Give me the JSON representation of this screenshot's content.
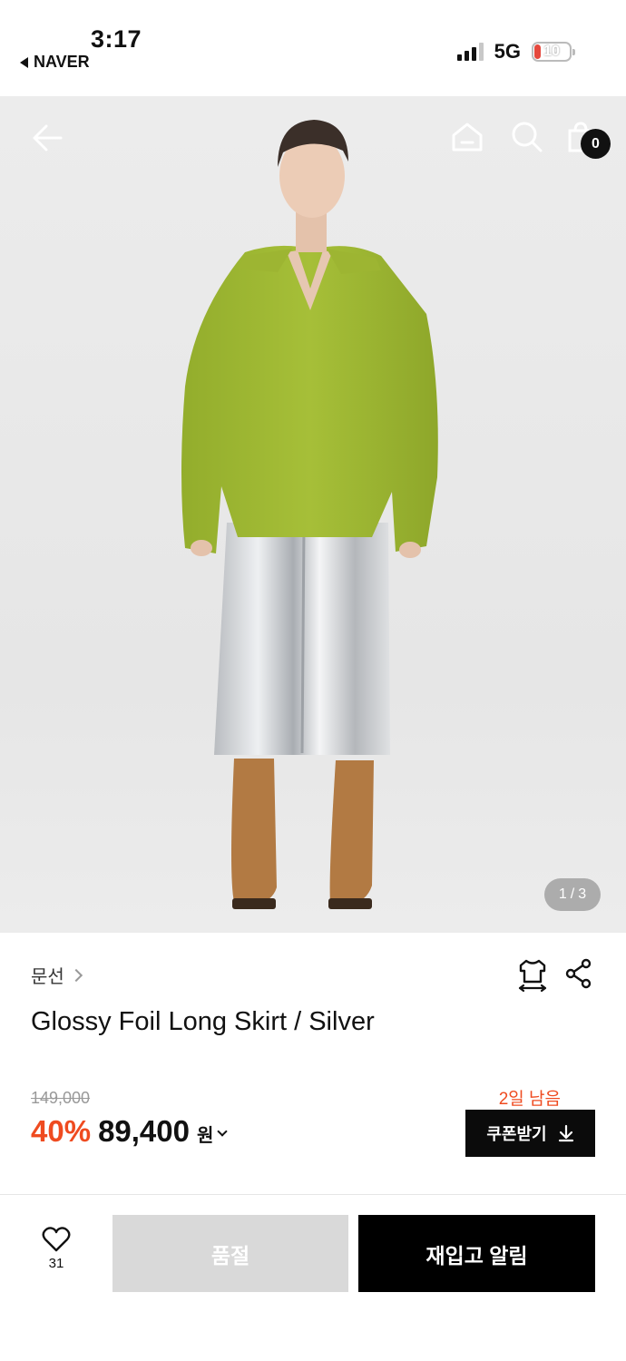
{
  "status_bar": {
    "time": "3:17",
    "back_app": "NAVER",
    "network": "5G",
    "battery": "10",
    "battery_color": "#e5483d"
  },
  "header": {
    "icons": [
      "back-arrow-icon",
      "home-icon",
      "search-icon",
      "shopping-bag-icon"
    ],
    "cart_count": "0"
  },
  "gallery": {
    "current": "1",
    "separator": "/",
    "total": "3"
  },
  "product": {
    "brand": "문선",
    "title": "Glossy Foil Long Skirt / Silver",
    "original_price": "149,000",
    "discount": "40%",
    "price": "89,400",
    "currency": "원",
    "days_left": "2일 남음",
    "coupon_label": "쿠폰받기",
    "accent_color": "#ef4b20"
  },
  "bottom_bar": {
    "like_count": "31",
    "soldout_label": "품절",
    "restock_label": "재입고 알림"
  }
}
